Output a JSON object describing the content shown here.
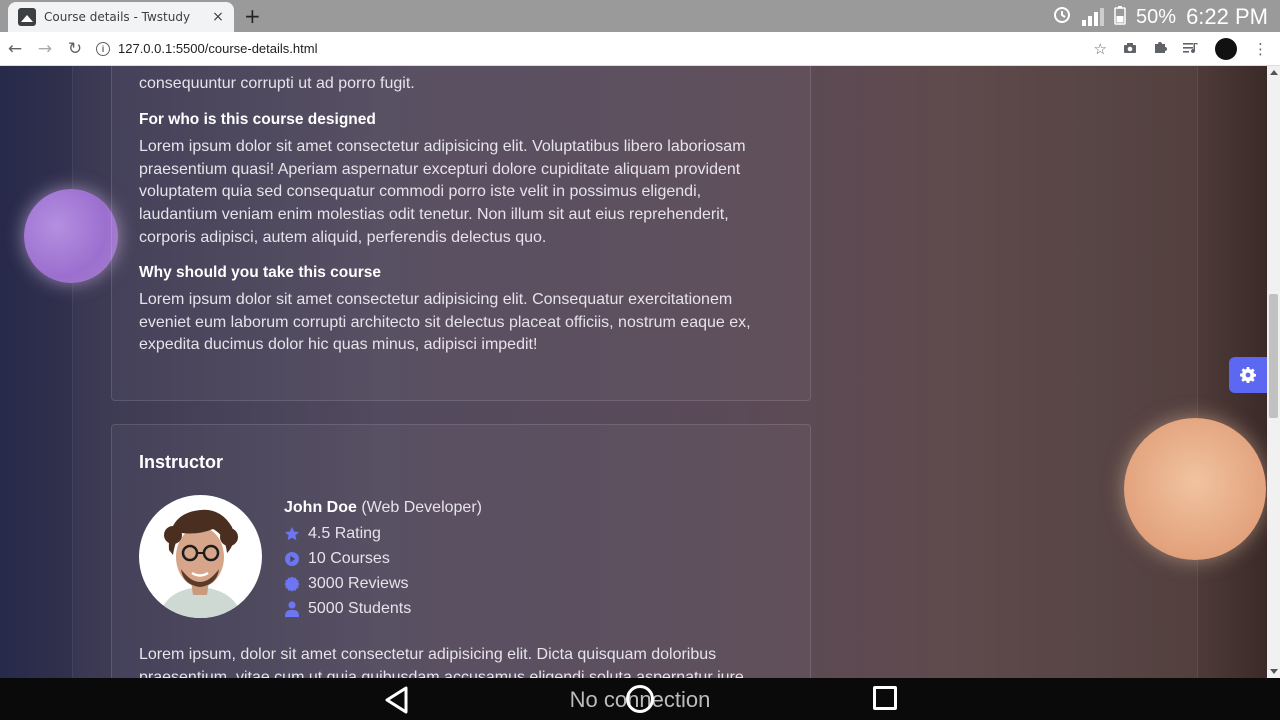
{
  "browser": {
    "tab_title": "Course details - Twstudy",
    "tab_close": "×",
    "new_tab": "+",
    "url": "127.0.0.1:5500/course-details.html"
  },
  "status_bar": {
    "battery_pct": "50%",
    "time": "6:22 PM"
  },
  "content": {
    "intro_tail": "consequuntur corrupti ut ad porro fugit.",
    "designed_for": {
      "heading": "For who is this course designed",
      "body": "Lorem ipsum dolor sit amet consectetur adipisicing elit. Voluptatibus libero laboriosam praesentium quasi! Aperiam aspernatur excepturi dolore cupiditate aliquam provident voluptatem quia sed consequatur commodi porro iste velit in possimus eligendi, laudantium veniam enim molestias odit tenetur. Non illum sit aut eius reprehenderit, corporis adipisci, autem aliquid, perferendis delectus quo."
    },
    "why_take": {
      "heading": "Why should you take this course",
      "body": "Lorem ipsum dolor sit amet consectetur adipisicing elit. Consequatur exercitationem eveniet eum laborum corrupti architecto sit delectus placeat officiis, nostrum eaque ex, expedita ducimus dolor hic quas minus, adipisci impedit!"
    }
  },
  "instructor": {
    "section_title": "Instructor",
    "name": "John Doe",
    "role": "(Web Developer)",
    "stats": [
      {
        "icon": "star-icon",
        "label": "4.5 Rating"
      },
      {
        "icon": "play-circle-icon",
        "label": "10 Courses"
      },
      {
        "icon": "badge-icon",
        "label": "3000 Reviews"
      },
      {
        "icon": "user-icon",
        "label": "5000 Students"
      }
    ],
    "bio": "Lorem ipsum, dolor sit amet consectetur adipisicing elit. Dicta quisquam doloribus praesentium, vitae cum ut quia quibusdam accusamus eligendi soluta aspernatur iure"
  },
  "android_nav": {
    "toast": "No connection"
  },
  "colors": {
    "accent": "#5c68f2",
    "icon_blue": "#6d75f2"
  }
}
